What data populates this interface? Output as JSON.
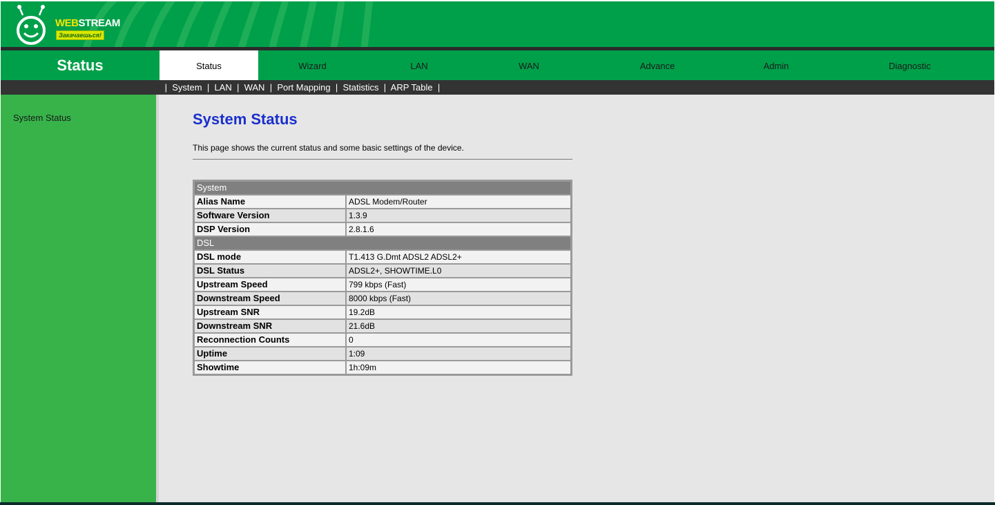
{
  "brand": {
    "name_part1": "WEB",
    "name_part2": "STREAM",
    "slogan": "Закачаешься!"
  },
  "section_title": "Status",
  "nav": {
    "tabs": [
      {
        "label": "Status",
        "active": true
      },
      {
        "label": "Wizard",
        "active": false
      },
      {
        "label": "LAN",
        "active": false
      },
      {
        "label": "WAN",
        "active": false
      },
      {
        "label": "Advance",
        "active": false
      },
      {
        "label": "Admin",
        "active": false
      },
      {
        "label": "Diagnostic",
        "active": false
      }
    ]
  },
  "subnav": {
    "links": [
      "System",
      "LAN",
      "WAN",
      "Port Mapping",
      "Statistics",
      "ARP Table"
    ],
    "separator": "|"
  },
  "sidebar": {
    "items": [
      {
        "label": "System Status"
      }
    ]
  },
  "content": {
    "title": "System Status",
    "description": "This page shows the current status and some basic settings of the device."
  },
  "status_table": {
    "system": {
      "header": "System",
      "rows": [
        {
          "label": "Alias Name",
          "value": "ADSL Modem/Router"
        },
        {
          "label": "Software Version",
          "value": "1.3.9"
        },
        {
          "label": "DSP Version",
          "value": "2.8.1.6"
        }
      ]
    },
    "dsl": {
      "header": "DSL",
      "rows": [
        {
          "label": "DSL mode",
          "value": "T1.413 G.Dmt ADSL2 ADSL2+"
        },
        {
          "label": "DSL Status",
          "value": "ADSL2+, SHOWTIME.L0"
        },
        {
          "label": "Upstream Speed",
          "value": "799 kbps  (Fast)"
        },
        {
          "label": "Downstream Speed",
          "value": "8000 kbps  (Fast)"
        },
        {
          "label": "Upstream SNR",
          "value": "19.2dB"
        },
        {
          "label": "Downstream SNR",
          "value": "21.6dB"
        },
        {
          "label": "Reconnection Counts",
          "value": "0"
        },
        {
          "label": "Uptime",
          "value": "1:09"
        },
        {
          "label": "Showtime",
          "value": "1h:09m"
        }
      ]
    }
  },
  "colors": {
    "header_green": "#00a04a",
    "sidebar_green": "#37b34a",
    "subnav_bg": "#333333",
    "title_blue": "#1a2fcc",
    "content_bg": "#e6e6e6"
  },
  "icons": {
    "logo": "smiley-antenna-logo-icon"
  }
}
